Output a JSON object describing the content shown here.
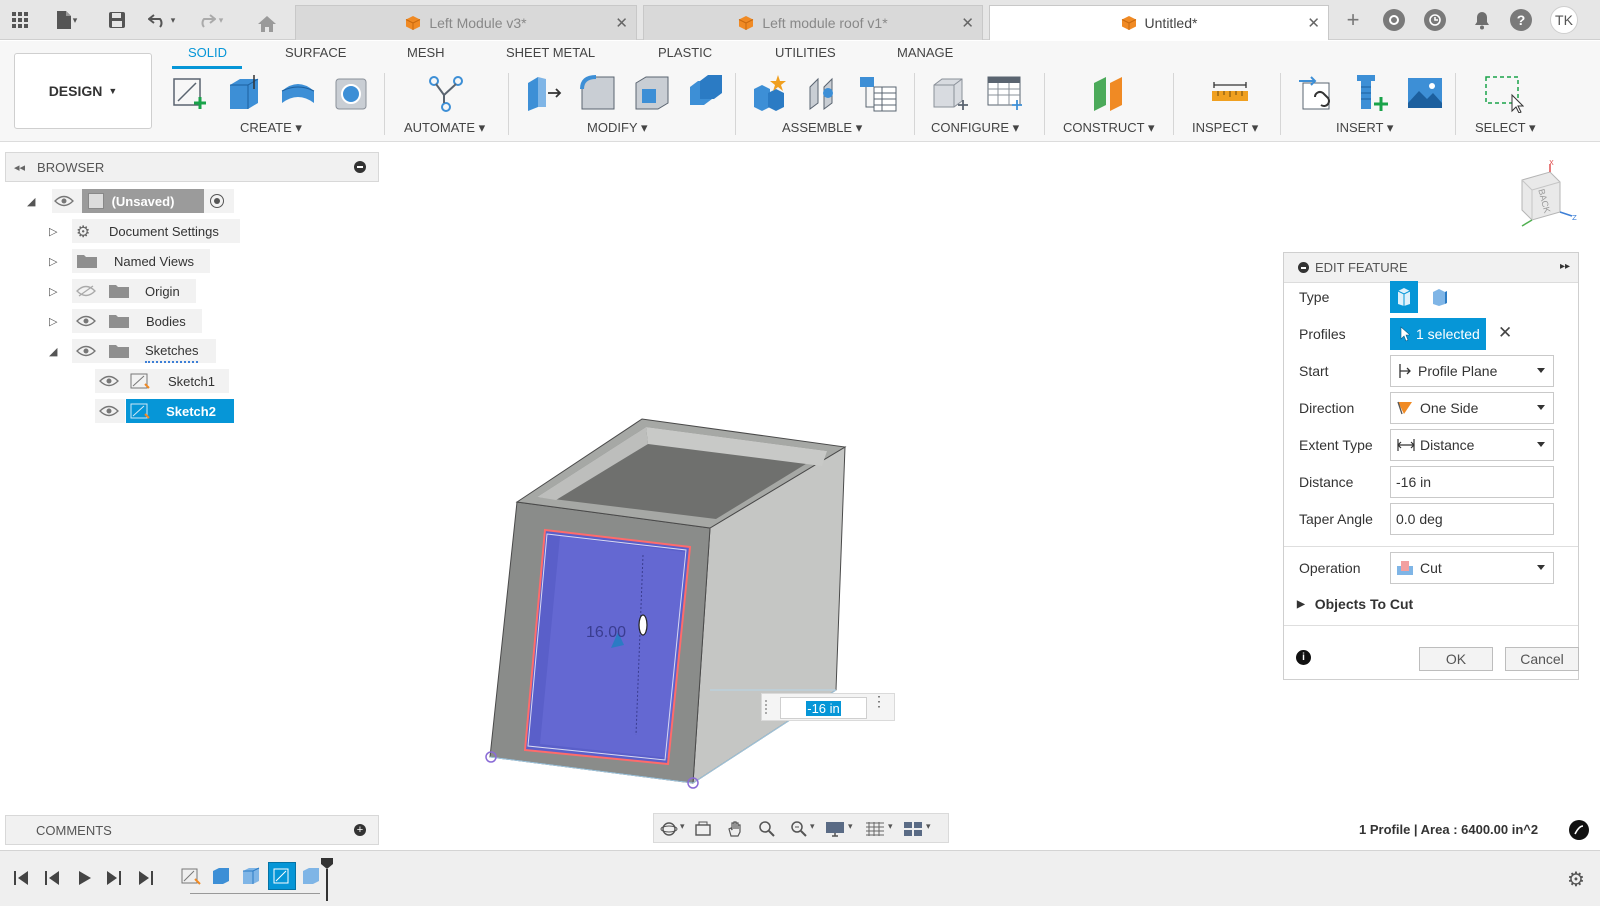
{
  "topbar": {
    "tabs": [
      {
        "label": "Left Module v3*"
      },
      {
        "label": "Left module roof v1*"
      },
      {
        "label": "Untitled*"
      }
    ],
    "close_glyph": "✕",
    "user_initials": "TK"
  },
  "ribbon": {
    "tabs": [
      "SOLID",
      "SURFACE",
      "MESH",
      "SHEET METAL",
      "PLASTIC",
      "UTILITIES",
      "MANAGE"
    ],
    "workspace_label": "DESIGN",
    "groups": [
      "CREATE",
      "AUTOMATE",
      "MODIFY",
      "ASSEMBLE",
      "CONFIGURE",
      "CONSTRUCT",
      "INSPECT",
      "INSERT",
      "SELECT"
    ]
  },
  "browser": {
    "title": "BROWSER",
    "root": "(Unsaved)",
    "items": [
      {
        "label": "Document Settings"
      },
      {
        "label": "Named Views"
      },
      {
        "label": "Origin"
      },
      {
        "label": "Bodies"
      },
      {
        "label": "Sketches"
      },
      {
        "label": "Sketch1"
      },
      {
        "label": "Sketch2"
      }
    ]
  },
  "viewport": {
    "viewcube_label": "BACK",
    "sketch_dim_text": "16.00",
    "distance_input": "-16 in"
  },
  "edit_feature": {
    "title": "EDIT FEATURE",
    "rows": {
      "type_label": "Type",
      "profiles_label": "Profiles",
      "profiles_value": "1 selected",
      "start_label": "Start",
      "start_value": "Profile Plane",
      "direction_label": "Direction",
      "direction_value": "One Side",
      "extent_label": "Extent Type",
      "extent_value": "Distance",
      "distance_label": "Distance",
      "distance_value": "-16 in",
      "taper_label": "Taper Angle",
      "taper_value": "0.0 deg",
      "operation_label": "Operation",
      "operation_value": "Cut",
      "objects_label": "Objects To Cut"
    },
    "ok_label": "OK",
    "cancel_label": "Cancel"
  },
  "comments": {
    "title": "COMMENTS"
  },
  "status": {
    "text": "1 Profile | Area : 6400.00 in^2"
  },
  "colors": {
    "accent": "#0696d7",
    "cut_profile": "#5a5fc9",
    "body_gray": "#8a8c8a"
  }
}
